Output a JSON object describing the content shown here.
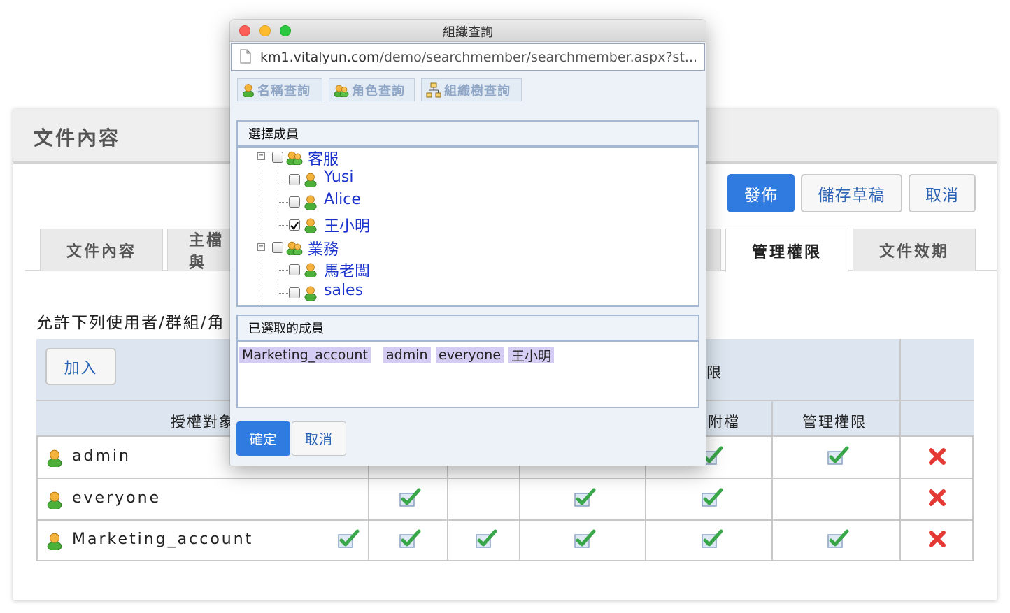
{
  "page": {
    "title": "文件內容",
    "actions": {
      "publish": "發佈",
      "save_draft": "儲存草稿",
      "cancel": "取消"
    },
    "tabs": [
      "文件內容",
      "主檔與",
      "管理權限",
      "文件效期"
    ],
    "active_tab": "管理權限",
    "permission_desc": "允許下列使用者/群組/角",
    "join_button": "加入",
    "table": {
      "group_header": "限",
      "headers": {
        "target": "授權對象",
        "attach": "附檔",
        "manage": "管理權限"
      },
      "rows": [
        {
          "name": "admin"
        },
        {
          "name": "everyone"
        },
        {
          "name": "Marketing_account"
        }
      ]
    }
  },
  "popup": {
    "window_title": "組織查詢",
    "url_host": "km1.vitalyun.com",
    "url_path": "/demo/searchmember/searchmember.aspx?st...",
    "query_tabs": [
      "名稱查詢",
      "角色查詢",
      "組織樹查詢"
    ],
    "select_members_label": "選擇成員",
    "tree": [
      {
        "label": "客服",
        "type": "group",
        "checked": false
      },
      {
        "label": "Yusi",
        "type": "user",
        "checked": false
      },
      {
        "label": "Alice",
        "type": "user",
        "checked": false
      },
      {
        "label": "王小明",
        "type": "user",
        "checked": true
      },
      {
        "label": "業務",
        "type": "group",
        "checked": false
      },
      {
        "label": "馬老闆",
        "type": "user",
        "checked": false
      },
      {
        "label": "sales",
        "type": "user",
        "checked": false
      }
    ],
    "selected_label": "已選取的成員",
    "selected": [
      "Marketing_account",
      "admin",
      "everyone",
      "王小明"
    ],
    "confirm": "確定",
    "cancel": "取消"
  },
  "colors": {
    "accent": "#2f7be0",
    "link": "#1a33cc",
    "check": "#4caf50",
    "delete": "#e53935"
  }
}
